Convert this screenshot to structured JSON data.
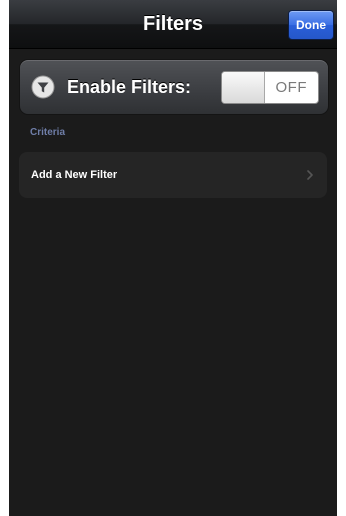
{
  "navbar": {
    "title": "Filters",
    "done_label": "Done"
  },
  "enable_filters": {
    "label": "Enable Filters:",
    "icon": "filter-icon",
    "toggle_state": "OFF",
    "enabled": false
  },
  "criteria": {
    "header": "Criteria",
    "items": [
      {
        "label": "Add a New Filter",
        "icon": "chevron-right-icon"
      }
    ]
  },
  "colors": {
    "done_button": "#2f63dc",
    "section_header": "#6f7ea8",
    "background": "#1b1b1b"
  }
}
